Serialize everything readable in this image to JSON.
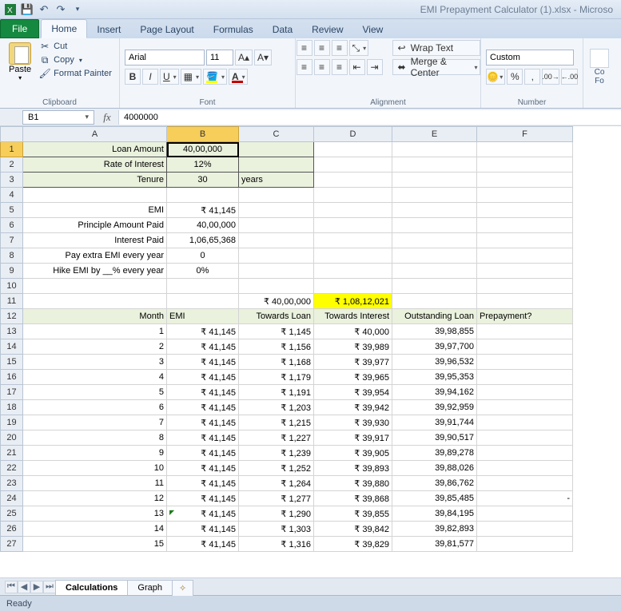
{
  "titlebar": {
    "title": "EMI Prepayment Calculator (1).xlsx  -  Microso"
  },
  "qat": {
    "save": "save-icon",
    "undo": "undo-icon",
    "redo": "redo-icon"
  },
  "tabs": {
    "file": "File",
    "home": "Home",
    "insert": "Insert",
    "page_layout": "Page Layout",
    "formulas": "Formulas",
    "data": "Data",
    "review": "Review",
    "view": "View"
  },
  "clipboard": {
    "paste": "Paste",
    "cut": "Cut",
    "copy": "Copy",
    "format_painter": "Format Painter",
    "group": "Clipboard"
  },
  "font": {
    "name": "Arial",
    "size": "11",
    "group": "Font"
  },
  "alignment": {
    "wrap": "Wrap Text",
    "merge": "Merge & Center",
    "group": "Alignment"
  },
  "number": {
    "format": "Custom",
    "group": "Number"
  },
  "namebox": "B1",
  "formula": "4000000",
  "cols": [
    "A",
    "B",
    "C",
    "D",
    "E",
    "F"
  ],
  "cells": {
    "A1": "Loan Amount",
    "B1": "40,00,000",
    "A2": "Rate of Interest",
    "B2": "12%",
    "A3": "Tenure",
    "B3": "30",
    "C3": "years",
    "A5": "EMI",
    "B5": "₹ 41,145",
    "A6": "Principle Amount Paid",
    "B6": "40,00,000",
    "A7": "Interest Paid",
    "B7": "1,06,65,368",
    "A8": "Pay extra EMI every year",
    "B8": "0",
    "A9": "Hike EMI by __% every year",
    "B9": "0%",
    "C11": "₹ 40,00,000",
    "D11": "₹ 1,08,12,021",
    "A12": "Month",
    "B12": "EMI",
    "C12": "Towards Loan",
    "D12": "Towards Interest",
    "E12": "Outstanding Loan",
    "F12": "Prepayment?"
  },
  "rows": [
    {
      "n": 1,
      "A": "1",
      "B": "₹ 41,145",
      "C": "₹ 1,145",
      "D": "₹ 40,000",
      "E": "39,98,855"
    },
    {
      "n": 2,
      "A": "2",
      "B": "₹ 41,145",
      "C": "₹ 1,156",
      "D": "₹ 39,989",
      "E": "39,97,700"
    },
    {
      "n": 3,
      "A": "3",
      "B": "₹ 41,145",
      "C": "₹ 1,168",
      "D": "₹ 39,977",
      "E": "39,96,532"
    },
    {
      "n": 4,
      "A": "4",
      "B": "₹ 41,145",
      "C": "₹ 1,179",
      "D": "₹ 39,965",
      "E": "39,95,353"
    },
    {
      "n": 5,
      "A": "5",
      "B": "₹ 41,145",
      "C": "₹ 1,191",
      "D": "₹ 39,954",
      "E": "39,94,162"
    },
    {
      "n": 6,
      "A": "6",
      "B": "₹ 41,145",
      "C": "₹ 1,203",
      "D": "₹ 39,942",
      "E": "39,92,959"
    },
    {
      "n": 7,
      "A": "7",
      "B": "₹ 41,145",
      "C": "₹ 1,215",
      "D": "₹ 39,930",
      "E": "39,91,744"
    },
    {
      "n": 8,
      "A": "8",
      "B": "₹ 41,145",
      "C": "₹ 1,227",
      "D": "₹ 39,917",
      "E": "39,90,517"
    },
    {
      "n": 9,
      "A": "9",
      "B": "₹ 41,145",
      "C": "₹ 1,239",
      "D": "₹ 39,905",
      "E": "39,89,278"
    },
    {
      "n": 10,
      "A": "10",
      "B": "₹ 41,145",
      "C": "₹ 1,252",
      "D": "₹ 39,893",
      "E": "39,88,026"
    },
    {
      "n": 11,
      "A": "11",
      "B": "₹ 41,145",
      "C": "₹ 1,264",
      "D": "₹ 39,880",
      "E": "39,86,762"
    },
    {
      "n": 12,
      "A": "12",
      "B": "₹ 41,145",
      "C": "₹ 1,277",
      "D": "₹ 39,868",
      "E": "39,85,485",
      "F": "-"
    },
    {
      "n": 13,
      "A": "13",
      "B": "₹ 41,145",
      "C": "₹ 1,290",
      "D": "₹ 39,855",
      "E": "39,84,195"
    },
    {
      "n": 14,
      "A": "14",
      "B": "₹ 41,145",
      "C": "₹ 1,303",
      "D": "₹ 39,842",
      "E": "39,82,893"
    },
    {
      "n": 15,
      "A": "15",
      "B": "₹ 41,145",
      "C": "₹ 1,316",
      "D": "₹ 39,829",
      "E": "39,81,577"
    }
  ],
  "sheet_tabs": {
    "calc": "Calculations",
    "graph": "Graph"
  },
  "status": "Ready"
}
